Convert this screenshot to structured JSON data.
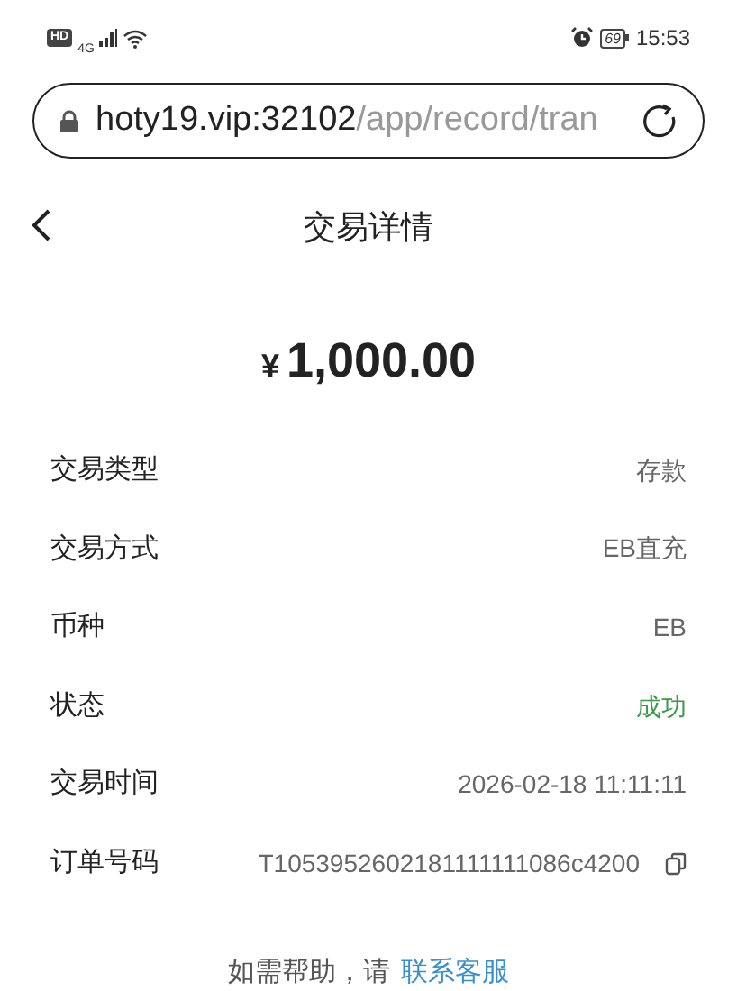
{
  "status_bar": {
    "hd": "HD",
    "network": "4G",
    "battery": "69",
    "time": "15:53"
  },
  "address_bar": {
    "host": "hoty19.vip:32102",
    "path": "/app/record/tran"
  },
  "header": {
    "title": "交易详情"
  },
  "amount": {
    "currency": "¥",
    "value": "1,000.00"
  },
  "rows": [
    {
      "kind": "plain",
      "label": "交易类型",
      "value": "存款"
    },
    {
      "kind": "plain",
      "label": "交易方式",
      "value": "EB直充"
    },
    {
      "kind": "plain",
      "label": "币种",
      "value": "EB"
    },
    {
      "kind": "status",
      "label": "状态",
      "value": "成功"
    },
    {
      "kind": "plain",
      "label": "交易时间",
      "value": "2026-02-18 11:11:11"
    },
    {
      "kind": "copy",
      "label": "订单号码",
      "value": "T1053952602181111111086c4200"
    }
  ],
  "help": {
    "text": "如需帮助，请",
    "link": "联系客服"
  }
}
